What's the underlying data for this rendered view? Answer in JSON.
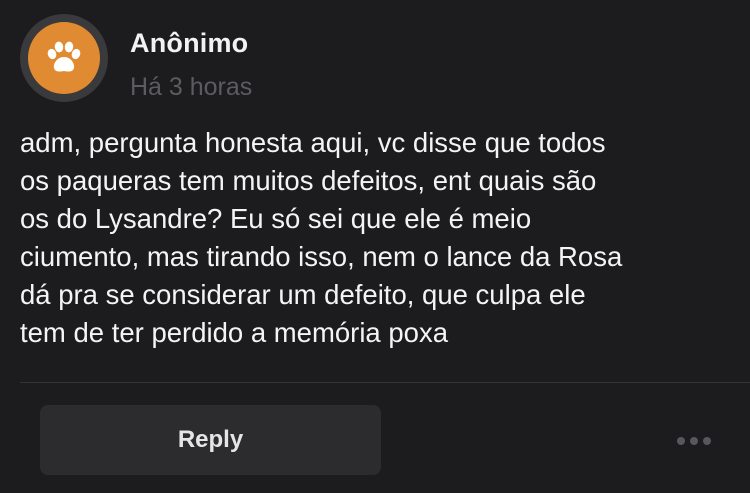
{
  "post": {
    "author": "Anônimo",
    "timestamp": "Há 3 horas",
    "avatar_icon": "paw-icon",
    "message": "adm, pergunta honesta aqui, vc disse que todos\nos paqueras tem muitos defeitos, ent quais são\nos do Lysandre? Eu só sei que ele é meio\nciumento, mas tirando isso, nem o lance da Rosa\ndá pra se considerar um defeito, que culpa ele\ntem de ter perdido a memória poxa"
  },
  "actions": {
    "reply_label": "Reply",
    "more_icon": "more-horizontal-icon"
  },
  "colors": {
    "background": "#1c1c1e",
    "avatar": "#e08a32",
    "button": "#2c2c2e"
  }
}
